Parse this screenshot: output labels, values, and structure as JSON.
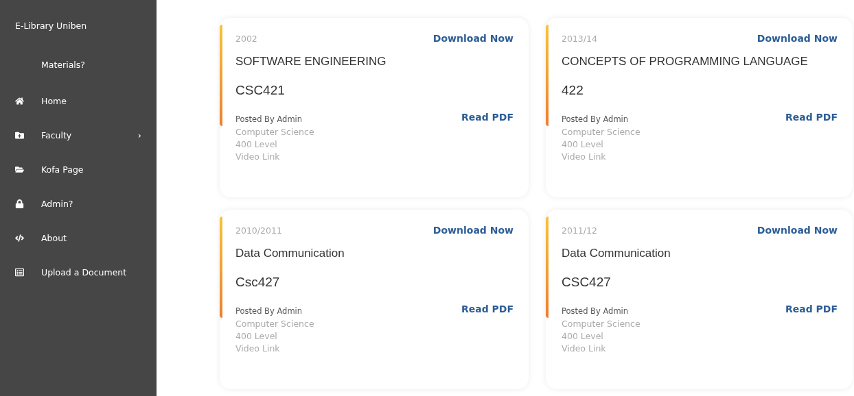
{
  "sidebar": {
    "brand": "E-Library Uniben",
    "subtitle": "Materials?",
    "items": [
      {
        "label": "Home"
      },
      {
        "label": "Faculty",
        "chevron": "›"
      },
      {
        "label": "Kofa Page"
      },
      {
        "label": "Admin?"
      },
      {
        "label": "About"
      },
      {
        "label": "Upload a Document"
      }
    ]
  },
  "cards": [
    {
      "year": "2002",
      "download": "Download Now",
      "title": "SOFTWARE ENGINEERING",
      "code": "CSC421",
      "posted_by": "Posted By Admin",
      "department": "Computer Science",
      "level": "400 Level",
      "video": "Video Link",
      "read": "Read PDF"
    },
    {
      "year": "2013/14",
      "download": "Download Now",
      "title": "CONCEPTS OF PROGRAMMING LANGUAGE",
      "code": "422",
      "posted_by": "Posted By Admin",
      "department": "Computer Science",
      "level": "400 Level",
      "video": "Video Link",
      "read": "Read PDF"
    },
    {
      "year": "2010/2011",
      "download": "Download Now",
      "title": "Data Communication",
      "code": "Csc427",
      "posted_by": "Posted By Admin",
      "department": "Computer Science",
      "level": "400 Level",
      "video": "Video Link",
      "read": "Read PDF"
    },
    {
      "year": "2011/12",
      "download": "Download Now",
      "title": "Data Communication",
      "code": "CSC427",
      "posted_by": "Posted By Admin",
      "department": "Computer Science",
      "level": "400 Level",
      "video": "Video Link",
      "read": "Read PDF"
    }
  ]
}
